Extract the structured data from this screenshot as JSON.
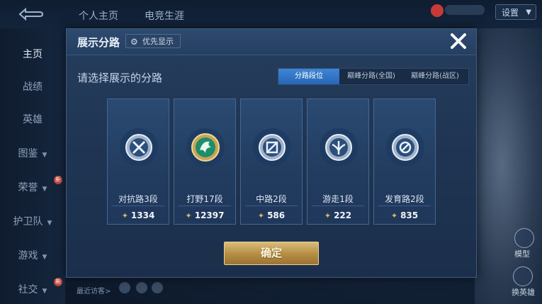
{
  "top_nav": {
    "tabs": [
      "个人主页",
      "电竞生涯"
    ],
    "settings_label": "设置"
  },
  "sidebar": {
    "items": [
      {
        "label": "主页",
        "active": true,
        "chevron": false,
        "new": false
      },
      {
        "label": "战绩",
        "active": false,
        "chevron": false,
        "new": false
      },
      {
        "label": "英雄",
        "active": false,
        "chevron": false,
        "new": false
      },
      {
        "label": "图鉴",
        "active": false,
        "chevron": true,
        "new": false
      },
      {
        "label": "荣誉",
        "active": false,
        "chevron": true,
        "new": true
      },
      {
        "label": "护卫队",
        "active": false,
        "chevron": true,
        "new": false
      },
      {
        "label": "游戏",
        "active": false,
        "chevron": true,
        "new": false
      },
      {
        "label": "社交",
        "active": false,
        "chevron": true,
        "new": true
      }
    ],
    "new_badge": "新"
  },
  "right_panel": {
    "labels": [
      "模型",
      "换英雄"
    ]
  },
  "bottom_hint": "最近访客>",
  "modal": {
    "title": "展示分路",
    "priority_button": "优先显示",
    "subtitle": "请选择展示的分路",
    "tabs": [
      {
        "label": "分路段位",
        "active": true
      },
      {
        "label": "巅峰分路(全国)",
        "active": false
      },
      {
        "label": "巅峰分路(战区)",
        "active": false
      }
    ],
    "cards": [
      {
        "role": "对抗路3段",
        "score": "1334",
        "emblem": "clash-lane-emblem"
      },
      {
        "role": "打野17段",
        "score": "12397",
        "emblem": "jungle-emblem"
      },
      {
        "role": "中路2段",
        "score": "586",
        "emblem": "mid-lane-emblem"
      },
      {
        "role": "游走1段",
        "score": "222",
        "emblem": "roam-emblem"
      },
      {
        "role": "发育路2段",
        "score": "835",
        "emblem": "farm-lane-emblem"
      }
    ],
    "confirm_label": "确定"
  },
  "colors": {
    "accent_tab": "#2f74c6",
    "confirm_gold": "#c7a35c",
    "modal_bg": "#223a5c"
  }
}
